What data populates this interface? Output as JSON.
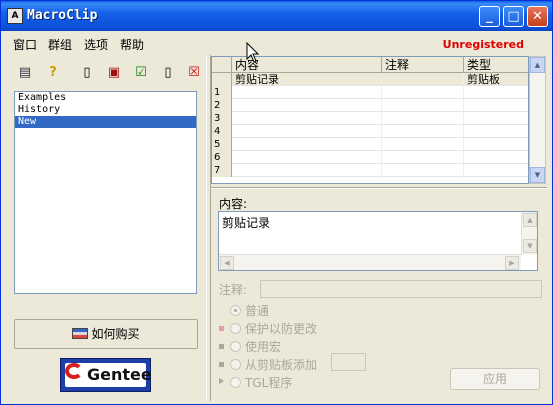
{
  "window": {
    "icon_text": "A",
    "title": "MacroClip",
    "minimize_glyph": "_",
    "maximize_glyph": "□",
    "close_glyph": "✕"
  },
  "menu": {
    "items": [
      "窗口",
      "群组",
      "选项",
      "帮助"
    ],
    "status": "Unregistered",
    "status_color": "#e00000"
  },
  "toolbar": {
    "icons": [
      "move-to-group-icon",
      "help-icon",
      "new-icon",
      "save-icon",
      "check-icon",
      "copy-icon",
      "delete-icon"
    ],
    "glyphs": [
      "▤",
      "?",
      "▯",
      "▣",
      "☑",
      "▯",
      "☒"
    ]
  },
  "groups": {
    "items": [
      "Examples",
      "History",
      "New"
    ],
    "selected": "New"
  },
  "buy_button": {
    "label": "如何购买"
  },
  "gentee": {
    "label": "Gentee"
  },
  "grid": {
    "columns": [
      "内容",
      "注释",
      "类型"
    ],
    "rows": [
      {
        "num": "",
        "content": "剪贴记录",
        "note": "",
        "type": "剪贴板"
      },
      {
        "num": "1",
        "content": "",
        "note": "",
        "type": ""
      },
      {
        "num": "2",
        "content": "",
        "note": "",
        "type": ""
      },
      {
        "num": "3",
        "content": "",
        "note": "",
        "type": ""
      },
      {
        "num": "4",
        "content": "",
        "note": "",
        "type": ""
      },
      {
        "num": "5",
        "content": "",
        "note": "",
        "type": ""
      },
      {
        "num": "6",
        "content": "",
        "note": "",
        "type": ""
      },
      {
        "num": "7",
        "content": "",
        "note": "",
        "type": ""
      }
    ]
  },
  "detail": {
    "content_label": "内容:",
    "content_value": "剪贴记录",
    "note_label": "注释:",
    "options": [
      {
        "label": "普通",
        "checked": true
      },
      {
        "label": "保护以防更改",
        "checked": false
      },
      {
        "label": "使用宏",
        "checked": false
      },
      {
        "label": "从剪贴板添加",
        "checked": false
      },
      {
        "label": "TGL程序",
        "checked": false
      }
    ],
    "apply_label": "应用"
  }
}
